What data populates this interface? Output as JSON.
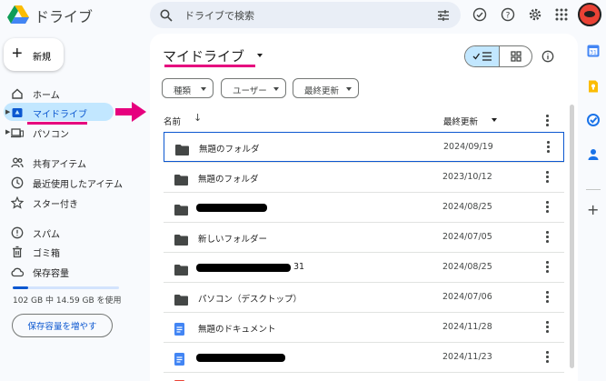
{
  "app": {
    "title": "ドライブ"
  },
  "search": {
    "placeholder": "ドライブで検索"
  },
  "nav": {
    "new_label": "新規",
    "items": [
      {
        "label": "ホーム"
      },
      {
        "label": "マイドライブ"
      },
      {
        "label": "パソコン"
      },
      {
        "label": "共有アイテム"
      },
      {
        "label": "最近使用したアイテム"
      },
      {
        "label": "スター付き"
      },
      {
        "label": "スパム"
      },
      {
        "label": "ゴミ箱"
      },
      {
        "label": "保存容量"
      }
    ],
    "storage_text": "102 GB 中 14.59 GB を使用",
    "storage_used_fraction": 0.143,
    "storage_button": "保存容量を増やす"
  },
  "main": {
    "title": "マイドライブ",
    "filters": [
      {
        "label": "種類"
      },
      {
        "label": "ユーザー"
      },
      {
        "label": "最終更新"
      }
    ],
    "columns": {
      "name": "名前",
      "modified": "最終更新"
    },
    "rows": [
      {
        "name": "無題のフォルダ",
        "date": "2024/09/19",
        "icon": "folder-icon"
      },
      {
        "name": "無題のフォルダ",
        "date": "2023/10/12",
        "icon": "folder-icon"
      },
      {
        "name": "",
        "date": "2024/08/25",
        "icon": "folder-icon"
      },
      {
        "name": "新しいフォルダー",
        "date": "2024/07/05",
        "icon": "folder-icon"
      },
      {
        "name": "31",
        "date": "2024/08/25",
        "icon": "folder-icon"
      },
      {
        "name": "パソコン（デスクトップ）",
        "date": "2024/07/06",
        "icon": "folder-icon"
      },
      {
        "name": "無題のドキュメント",
        "date": "2024/11/28",
        "icon": "docs-icon"
      },
      {
        "name": "",
        "date": "2024/11/23",
        "icon": "docs-icon"
      }
    ]
  },
  "colors": {
    "accent": "#0b57d0",
    "active_nav": "#c2e7ff",
    "annotation": "#e6007e",
    "docs_blue": "#4285f4"
  }
}
